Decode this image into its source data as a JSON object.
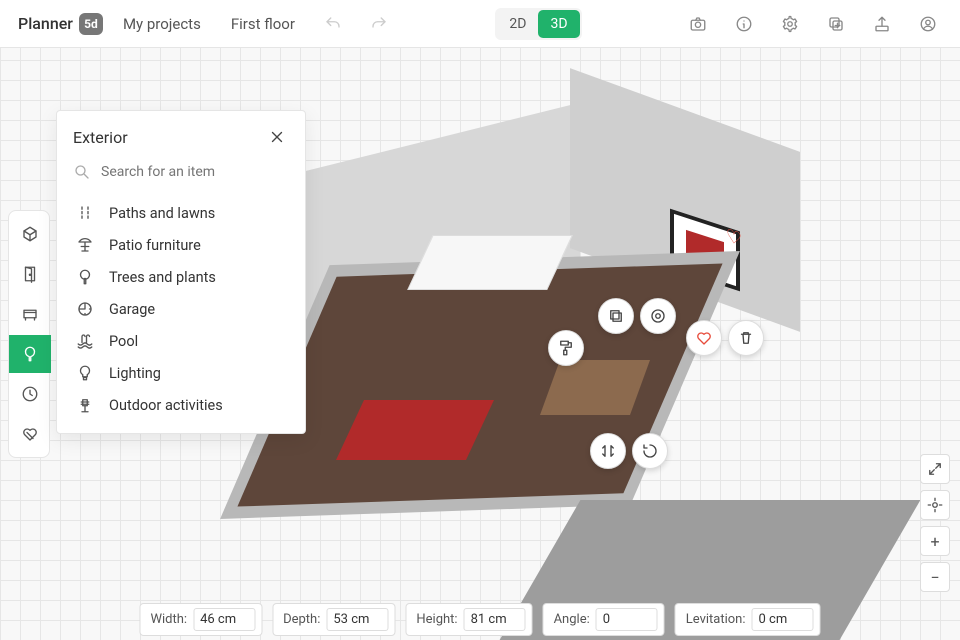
{
  "brand": {
    "name": "Planner",
    "badge": "5d"
  },
  "topbar": {
    "my_projects": "My projects",
    "floor_label": "First floor",
    "view2d": "2D",
    "view3d": "3D"
  },
  "panel": {
    "title": "Exterior",
    "search_placeholder": "Search for an item",
    "categories": [
      {
        "id": "paths",
        "label": "Paths and lawns"
      },
      {
        "id": "patio",
        "label": "Patio furniture"
      },
      {
        "id": "trees",
        "label": "Trees and plants"
      },
      {
        "id": "garage",
        "label": "Garage"
      },
      {
        "id": "pool",
        "label": "Pool"
      },
      {
        "id": "lighting",
        "label": "Lighting"
      },
      {
        "id": "outdoor",
        "label": "Outdoor activities"
      }
    ]
  },
  "bottom": {
    "width_label": "Width:",
    "width_value": "46 cm",
    "depth_label": "Depth:",
    "depth_value": "53 cm",
    "height_label": "Height:",
    "height_value": "81 cm",
    "angle_label": "Angle:",
    "angle_value": "0",
    "lev_label": "Levitation:",
    "lev_value": "0 cm"
  },
  "tools": {
    "build": "build-tool",
    "doors": "doors-tool",
    "furniture": "furniture-tool",
    "exterior": "exterior-tool",
    "history": "history-tool",
    "favorites": "favorites-tool"
  }
}
